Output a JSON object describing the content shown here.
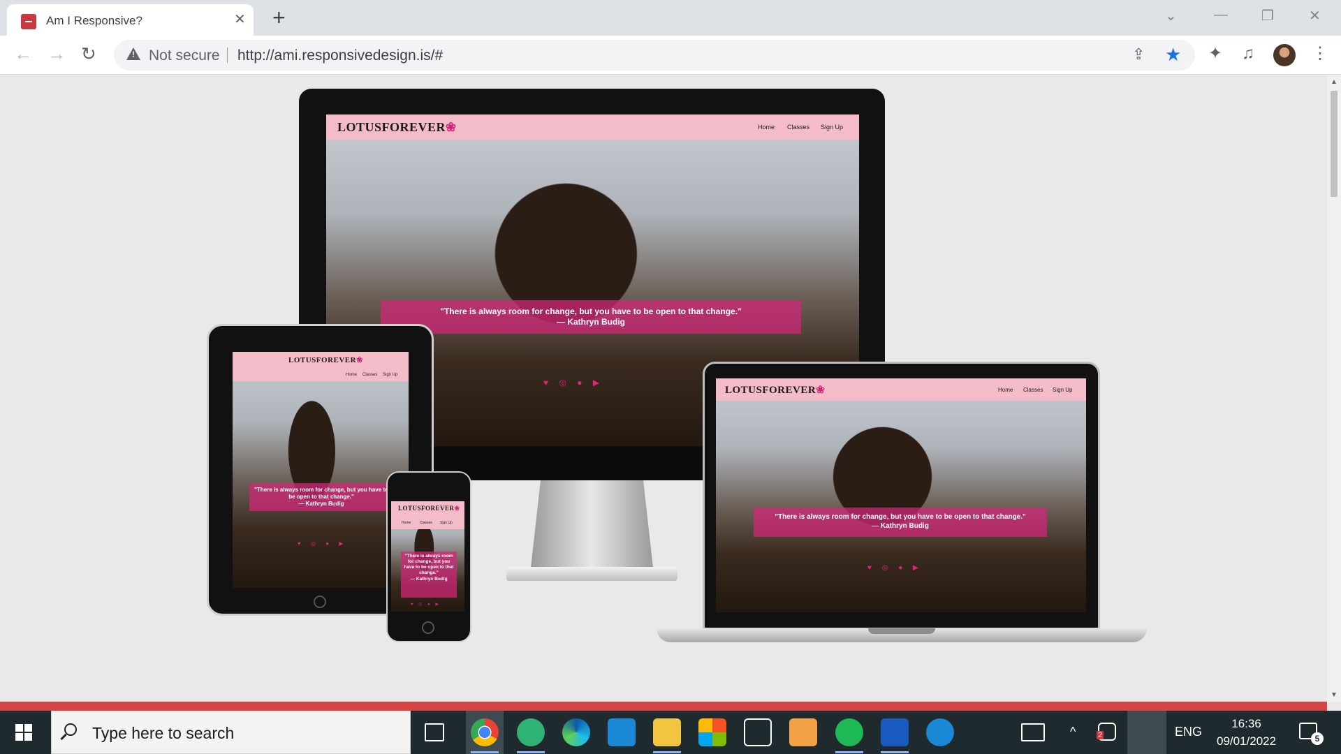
{
  "browser": {
    "tab_title": "Am I Responsive?",
    "tab_close": "✕",
    "new_tab": "+",
    "security_label": "Not secure",
    "url": "http://ami.responsivedesign.is/#",
    "back": "←",
    "forward": "→",
    "reload": "↻",
    "window_minimize": "—",
    "window_restore": "❐",
    "window_close": "✕",
    "tab_search": "⌄",
    "share_icon": "⇪",
    "star_icon": "★",
    "extensions_icon": "✦",
    "media_icon": "♫",
    "menu_icon": "⋮"
  },
  "site": {
    "logo_text": "LOTUSFOREVER",
    "logo_mark": "❀",
    "nav": [
      "Home",
      "Classes",
      "Sign Up"
    ],
    "quote_line1": "\"There is always room for change, but you have to be open to that change.\"",
    "quote_author": "— Kathryn Budig",
    "phone_quote": "\"There is always room for change, but you have to be open to that change.\"",
    "tablet_quote": "\"There is always room for change, but you have to be open to that change.\"",
    "social_icons": "♥ ◎ ● ▶"
  },
  "taskbar": {
    "search_placeholder": "Type here to search",
    "language": "ENG",
    "time": "16:36",
    "date": "09/01/2022",
    "notifications": "5",
    "tray_up": "^",
    "app_badge": "2"
  },
  "colors": {
    "accent_pink": "#d6257a",
    "header_pink": "#f4bcc8",
    "chrome_blue": "#1a73e8",
    "red_strip": "#d64545"
  }
}
